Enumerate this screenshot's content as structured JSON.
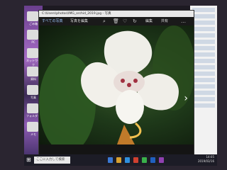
{
  "viewer": {
    "title": "C:\\Users\\photos\\IMG_orchid_2019.jpg - 写真",
    "toolbar": {
      "collection_label": "すべての写真",
      "edit_label": "写真を編集",
      "edit_right_label": "編集",
      "share_label": "共有"
    }
  },
  "taskbar": {
    "search_placeholder": "ここに入力して検索",
    "time": "14:05",
    "date": "2019/03/16"
  },
  "desktop": {
    "icon_labels": [
      "ごみ箱",
      "PC",
      "ネットワーク",
      "資料",
      "写真",
      "フォルダー",
      "メモ"
    ]
  }
}
